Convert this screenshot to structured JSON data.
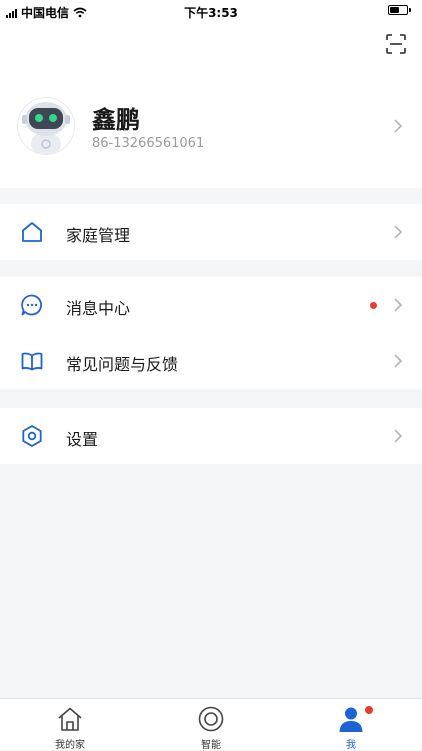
{
  "status_bar": {
    "carrier": "中国电信",
    "time": "下午3:53"
  },
  "profile": {
    "name": "鑫鹏",
    "phone": "86-13266561061"
  },
  "menu": {
    "home_management": "家庭管理",
    "message_center": "消息中心",
    "faq_feedback": "常见问题与反馈",
    "settings": "设置"
  },
  "tabbar": {
    "tabs": [
      {
        "label": "我的家",
        "active": false
      },
      {
        "label": "智能",
        "active": false
      },
      {
        "label": "我",
        "active": true
      }
    ]
  },
  "colors": {
    "accent": "#1c63d6",
    "badge": "#e43d30",
    "background": "#f4f5f7"
  },
  "icons": [
    "wifi-icon",
    "scan-icon",
    "robot-avatar",
    "home-icon",
    "chat-icon",
    "book-icon",
    "hexagon-settings-icon",
    "chevron-right-icon",
    "tab-home-icon",
    "tab-smart-icon",
    "tab-user-icon"
  ]
}
